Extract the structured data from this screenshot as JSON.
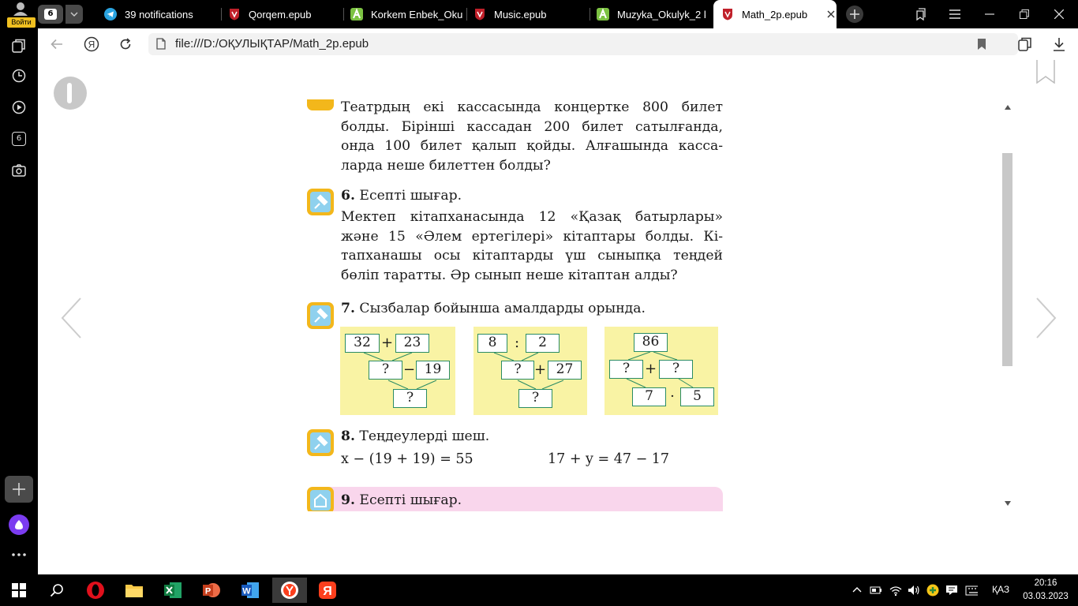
{
  "profile": {
    "login_label": "Войти"
  },
  "tab_counter": "6",
  "tabs": [
    {
      "label": "39 notifications",
      "icon": "telegram-icon"
    },
    {
      "label": "Qorqem.epub",
      "icon": "epub-shield-icon"
    },
    {
      "label": "Korkem Enbek_Oku",
      "icon": "android-a-icon"
    },
    {
      "label": "Music.epub",
      "icon": "epub-shield-icon"
    },
    {
      "label": "Muzyka_Okulyk_2 k",
      "icon": "android-a-icon"
    },
    {
      "label": "Math_2p.epub",
      "icon": "epub-shield-icon",
      "active": true
    }
  ],
  "address": {
    "url": "file:///D:/ОҚУЛЫҚТАР/Math_2p.epub"
  },
  "sidebar": {
    "counter_badge": "6"
  },
  "page": {
    "task5_lines": [
      "Театрдың екі кассасында концертке 800 билет",
      "болды. Бірінші кассадан 200 билет сатылғанда,",
      "онда 100 билет қалып қойды. Алғашында касса-",
      "ларда неше билеттен болды?"
    ],
    "task6": {
      "number": "6.",
      "title": "Есепті шығар.",
      "lines": [
        "Мектеп кітапханасында 12 «Қазақ батырлары»",
        "және 15 «Әлем ертегілері» кітаптары болды. Кі-",
        "тапханашы осы кітаптарды үш сыныпқа теңдей",
        "бөліп таратты. Әр сынып неше кітаптан алды?"
      ]
    },
    "task7": {
      "number": "7.",
      "title": "Сызбалар бойынша амалдарды орында.",
      "schema1": {
        "a": "32",
        "op1": "+",
        "b": "23",
        "c": "?",
        "op2": "−",
        "d": "19",
        "r": "?"
      },
      "schema2": {
        "a": "8",
        "op1": ":",
        "b": "2",
        "c": "?",
        "op2": "+",
        "d": "27",
        "r": "?"
      },
      "schema3": {
        "top": "86",
        "a": "?",
        "op1": "+",
        "b": "?",
        "c": "7",
        "op2": "·",
        "d": "5"
      }
    },
    "task8": {
      "number": "8.",
      "title": "Теңдеулерді шеш.",
      "eq1": "x − (19 + 19) = 55",
      "eq2": "17 + y = 47 − 17"
    },
    "task9": {
      "number": "9.",
      "title": "Есепті шығар."
    }
  },
  "taskbar": {
    "apps": [
      "windows-start-icon",
      "search-icon",
      "opera-icon",
      "file-explorer-icon",
      "excel-icon",
      "powerpoint-icon",
      "word-icon",
      "yandex-browser-icon",
      "yandex-icon"
    ],
    "language": "ҚАЗ",
    "time": "20:16",
    "date": "03.03.2023"
  },
  "colors": {
    "accent_yellow": "#f3b71b",
    "schema_bg": "#f9f3a4",
    "box_border": "#2a8c64",
    "task9_bg": "#f9d6ec"
  }
}
